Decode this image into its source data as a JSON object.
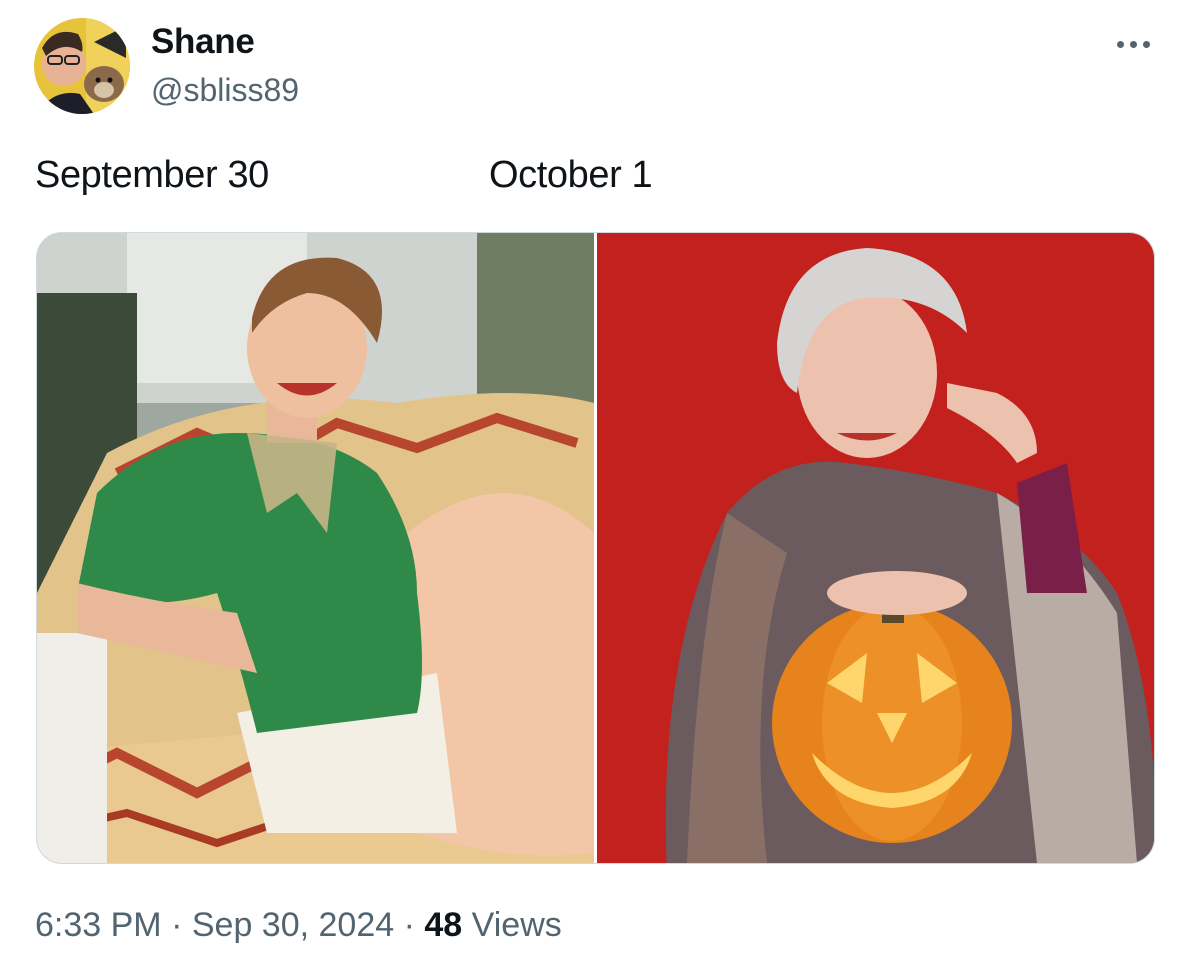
{
  "tweet": {
    "author_name": "Shane",
    "author_handle": "@sbliss89",
    "text_left": "September 30",
    "text_right": "October 1",
    "time": "6:33 PM",
    "date": "Sep 30, 2024",
    "separator": "·",
    "views_count": "48",
    "views_label": "Views"
  },
  "icons": {
    "more": "more-horizontal-icon"
  },
  "colors": {
    "text_primary": "#0f1419",
    "text_secondary": "#536471",
    "border": "#cfd9de",
    "right_photo_background": "#c8231f",
    "left_photo_sweater": "#2f8a4a"
  }
}
